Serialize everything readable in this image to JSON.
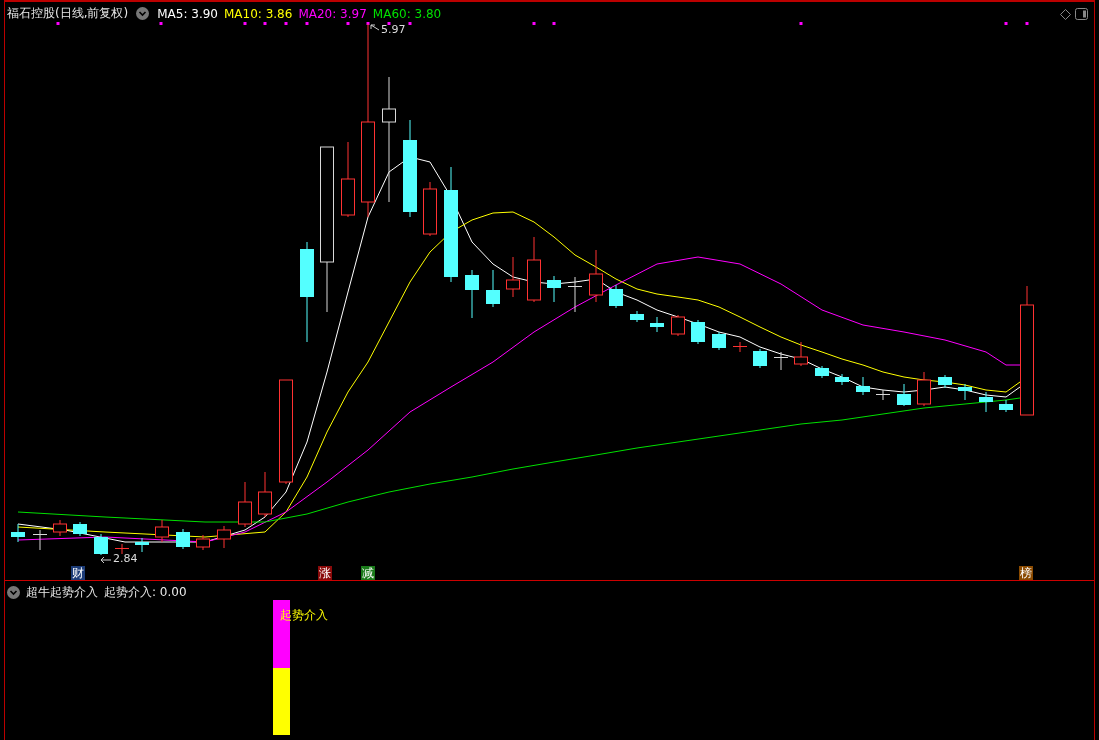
{
  "header": {
    "title": "福石控股(日线,前复权)",
    "ma": [
      {
        "label": "MA5: 3.90",
        "color": "#ffffff"
      },
      {
        "label": "MA10: 3.86",
        "color": "#ffff00"
      },
      {
        "label": "MA20: 3.97",
        "color": "#ff00ff"
      },
      {
        "label": "MA60: 3.80",
        "color": "#00e000"
      }
    ]
  },
  "price_marks": [
    {
      "text": "5.97"
    },
    {
      "text": "2.84"
    }
  ],
  "signals": [
    {
      "text": "财",
      "color": "#1c3c78"
    },
    {
      "text": "涨",
      "color": "#8a0a0a"
    },
    {
      "text": "减",
      "color": "#1a7a1a"
    },
    {
      "text": "榜",
      "color": "#8a4a00"
    }
  ],
  "indicator": {
    "title": "超牛起势介入",
    "reading": "起势介入: 0.00",
    "bar_label": "起势介入"
  }
}
